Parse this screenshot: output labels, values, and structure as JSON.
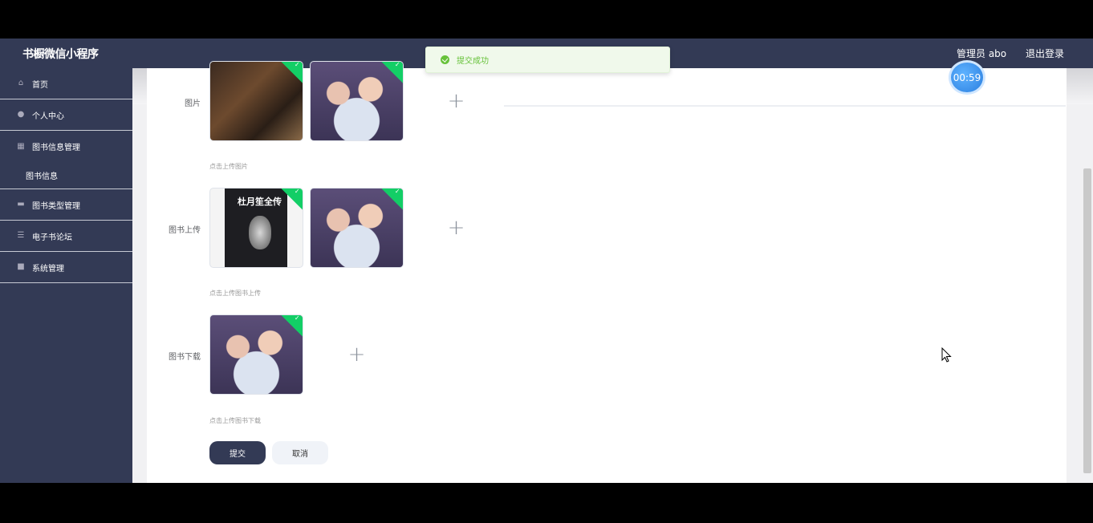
{
  "header": {
    "app_title": "书橱微信小程序",
    "user_label": "管理员 abo",
    "logout_label": "退出登录"
  },
  "sidebar": {
    "items": [
      {
        "label": "首页",
        "icon": "home-icon"
      },
      {
        "label": "个人中心",
        "icon": "user-icon"
      },
      {
        "label": "图书信息管理",
        "icon": "book-icon"
      },
      {
        "label": "图书信息",
        "icon": ""
      },
      {
        "label": "图书类型管理",
        "icon": "tag-icon"
      },
      {
        "label": "电子书论坛",
        "icon": "list-icon"
      },
      {
        "label": "系统管理",
        "icon": "settings-icon"
      }
    ]
  },
  "toast": {
    "message": "提交成功"
  },
  "timer": {
    "value": "00:59"
  },
  "form": {
    "rows": [
      {
        "label": "图片",
        "hint": "点击上传图片"
      },
      {
        "label": "图书上传",
        "hint": "点击上传图书上传"
      },
      {
        "label": "图书下载",
        "hint": "点击上传图书下载"
      }
    ],
    "submit_label": "提交",
    "cancel_label": "取消",
    "plus_symbol": "+",
    "check_symbol": "✓"
  },
  "book_cover": {
    "title": "杜月笙全传"
  },
  "colors": {
    "sidebar_bg": "#333a55",
    "success_green": "#13ce66",
    "toast_bg": "#f0f9eb"
  }
}
